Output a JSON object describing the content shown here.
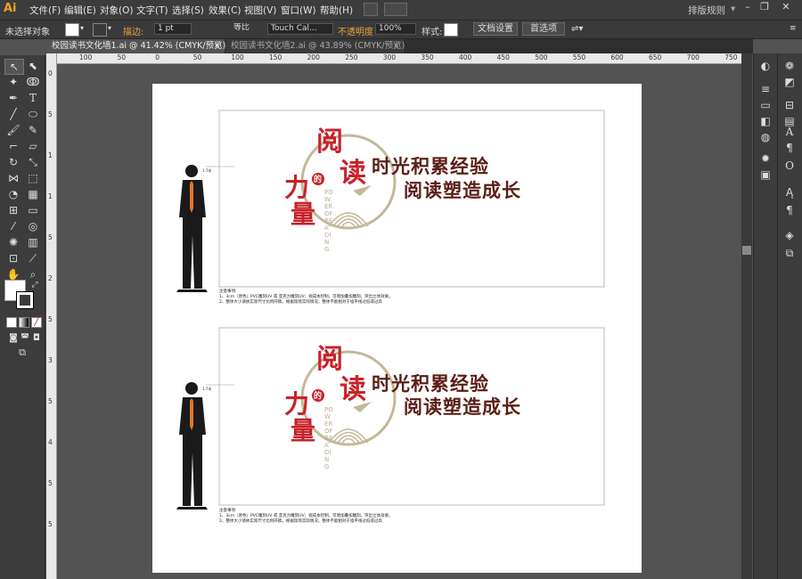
{
  "app": {
    "logo": "Ai",
    "workspace": "排版规则"
  },
  "menu": [
    "文件(F)",
    "编辑(E)",
    "对象(O)",
    "文字(T)",
    "选择(S)",
    "效果(C)",
    "视图(V)",
    "窗口(W)",
    "帮助(H)"
  ],
  "window_controls": [
    "–",
    "❐",
    "✕"
  ],
  "control_bar": {
    "selection": "未选择对象",
    "stroke_label": "描边:",
    "stroke_weight": "1 pt",
    "stroke_profile": "等比",
    "brush": "Touch Cal...",
    "opacity_label": "不透明度",
    "opacity_value": "100%",
    "style_label": "样式:",
    "doc_setup": "文档设置",
    "preferences": "首选项"
  },
  "tabs": [
    {
      "label": "校园读书文化墙1.ai @ 41.42% (CMYK/预览)",
      "active": true,
      "close": "✕"
    },
    {
      "label": "校园读书文化墙2.ai @ 43.89% (CMYK/预览)",
      "active": false,
      "close": "✕"
    }
  ],
  "ruler_h": [
    "100",
    "50",
    "0",
    "50",
    "100",
    "150",
    "200",
    "250",
    "300",
    "350",
    "400",
    "450",
    "500",
    "550",
    "600",
    "650",
    "700",
    "750"
  ],
  "ruler_v": [
    "0",
    "5",
    "1",
    "1",
    "5",
    "2",
    "5",
    "3",
    "5",
    "4",
    "5",
    "5"
  ],
  "designs": [
    {
      "yue": "阅",
      "du": "读",
      "de": "的",
      "li": "力",
      "liang": "量",
      "power": "POWER OF READING",
      "slogan1": "时光积累经验",
      "slogan2": "阅读塑造成长",
      "scale_label": "1.7米",
      "notes_title": "注意事项:",
      "note1": "1、3cm（原色）PVC雕刻UV 或 亚克力雕刻UV；视成本控制，可增加叠加雕刻，突出立体效果。",
      "note2": "2、整体大小请依实际尺寸比例开稿，根据现场实际情况，整体不能相对于墙平线过低或过高"
    },
    {
      "yue": "阅",
      "du": "读",
      "de": "的",
      "li": "力",
      "liang": "量",
      "power": "POWER OF READING",
      "slogan1": "时光积累经验",
      "slogan2": "阅读塑造成长",
      "scale_label": "1.7米",
      "notes_title": "注意事项:",
      "note1": "1、3cm（原色）PVC雕刻UV 或 亚克力雕刻UV；视成本控制，可增加叠加雕刻，突出立体效果。",
      "note2": "2、整体大小请依实际尺寸比例开稿，根据现场实际情况，整体不能相对于墙平线过低或过高"
    }
  ],
  "colors": {
    "accent_red": "#c8222a",
    "slogan_brown": "#5a1e14",
    "circle_tan": "#c4b89a",
    "tie_orange": "#e0762a"
  }
}
